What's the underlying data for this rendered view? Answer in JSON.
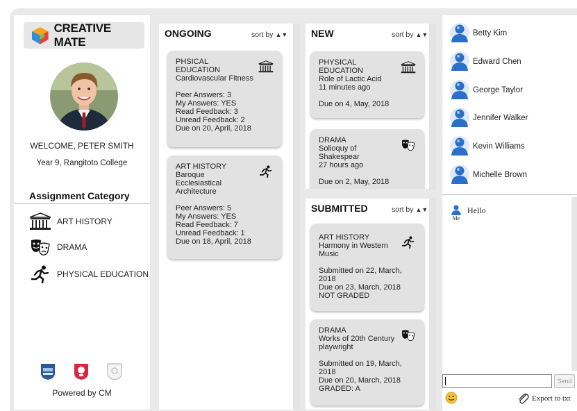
{
  "app": {
    "logo_text": "CREATIVE MATE"
  },
  "profile": {
    "welcome": "WELCOME, PETER SMITH",
    "school": "Year 9, Rangitoto College"
  },
  "categories": {
    "title": "Assignment Category",
    "items": [
      {
        "label": "ART HISTORY",
        "icon": "museum-icon"
      },
      {
        "label": "DRAMA",
        "icon": "theater-masks-icon"
      },
      {
        "label": "PHYSICAL EDUCATION",
        "icon": "running-icon"
      }
    ]
  },
  "footer": {
    "powered": "Powered by CM"
  },
  "columns": {
    "ongoing": {
      "title": "ONGOING",
      "sort": "sort by",
      "cards": [
        {
          "subject": "PHSICAL EDUCATION",
          "subject_l1": "PHSICAL",
          "subject_l2": "EDUCATION",
          "title": "Cardiovascular Fitness",
          "peer": "Peer Answers: 3",
          "my": "My Answers: YES",
          "read": "Read Feedback: 3",
          "unread": "Unread Feedback: 2",
          "due": "Due on 20, April, 2018"
        },
        {
          "subject": "ART HISTORY",
          "title_l1": "Baroque",
          "title_l2": "Ecclesiastical",
          "title_l3": "Architecture",
          "peer": "Peer Answers: 5",
          "my": "My Answers: YES",
          "read": "Read Feedback: 7",
          "unread": "Unread Feedback: 1",
          "due": "Due on 18, April, 2018"
        }
      ]
    },
    "new": {
      "title": "NEW",
      "sort": "sort by",
      "cards": [
        {
          "subject_l1": "PHYSICAL",
          "subject_l2": "EDUCATION",
          "title": "Role of Lactic Acid",
          "ago": "11 minutes ago",
          "due": "Due on 4, May, 2018"
        },
        {
          "subject": "DRAMA",
          "title_l1": "Solioquy of",
          "title_l2": "Shakespear",
          "ago": "27 hours ago",
          "due": "Due on 2, May, 2018"
        }
      ]
    },
    "submitted": {
      "title": "SUBMITTED",
      "sort": "sort by",
      "cards": [
        {
          "subject": "ART HISTORY",
          "title_l1": "Harmony in Western",
          "title_l2": "Music",
          "sub_l1": "Submitted on 22, March,",
          "sub_l2": "2018",
          "due": "Due on 23, March, 2018",
          "grade": "NOT GRADED"
        },
        {
          "subject": "DRAMA",
          "title_l1": "Works of 20th Century",
          "title_l2": "playwright",
          "sub_l1": "Submitted on 19, March,",
          "sub_l2": "2018",
          "due": "Due on 20, March, 2018",
          "grade": "GRADED: A"
        }
      ]
    }
  },
  "chat": {
    "contacts": [
      "Betty Kim",
      "Edward Chen",
      "George Taylor",
      "Jennifer Walker",
      "Kevin Williams",
      "Michelle Brown"
    ],
    "messages": [
      {
        "user": "Me",
        "text": "Hello"
      }
    ],
    "input_value": "",
    "send_label": "Send",
    "export_label": "Export to txt"
  }
}
